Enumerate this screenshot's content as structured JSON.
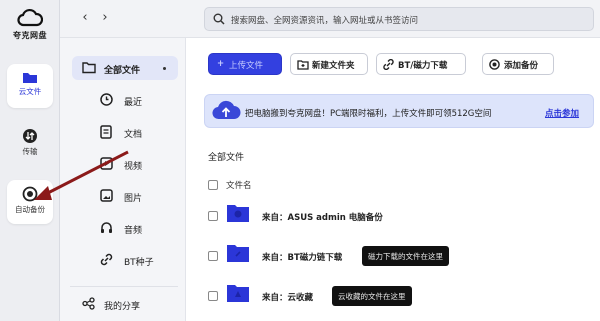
{
  "app": {
    "name": "夸克网盘"
  },
  "rail": {
    "items": [
      {
        "label": "云文件",
        "icon": "cloud-file-icon"
      },
      {
        "label": "传输",
        "icon": "transfer-icon"
      },
      {
        "label": "自动备份",
        "icon": "auto-backup-icon"
      }
    ]
  },
  "topbar": {
    "back": "‹",
    "forward": "›",
    "search_placeholder": "搜索网盘、全网资源资讯，输入网址或从书签访问"
  },
  "sidebar": {
    "items": [
      {
        "label": "全部文件",
        "icon": "folder-icon",
        "active": true
      },
      {
        "label": "最近",
        "icon": "clock-icon"
      },
      {
        "label": "文档",
        "icon": "document-icon"
      },
      {
        "label": "视频",
        "icon": "video-icon"
      },
      {
        "label": "图片",
        "icon": "image-icon"
      },
      {
        "label": "音频",
        "icon": "headphones-icon"
      },
      {
        "label": "BT种子",
        "icon": "link-icon"
      }
    ],
    "share": {
      "label": "我的分享",
      "icon": "share-icon"
    }
  },
  "toolbar": {
    "upload": "上传文件",
    "new_folder": "新建文件夹",
    "bt_download": "BT/磁力下载",
    "add_backup": "添加备份"
  },
  "banner": {
    "text": "把电脑搬到夸克网盘！PC端限时福利，上传文件即可领512G空间",
    "link": "点击参加"
  },
  "files": {
    "section_title": "全部文件",
    "column_name": "文件名",
    "rows": [
      {
        "name": "来自：ASUS admin 电脑备份",
        "tooltip": ""
      },
      {
        "name": "来自：BT磁力链下载",
        "tooltip": "磁力下载的文件在这里"
      },
      {
        "name": "来自：云收藏",
        "tooltip": "云收藏的文件在这里"
      }
    ]
  },
  "colors": {
    "accent": "#3340e0",
    "folder": "#2b36d8",
    "arrow": "#8b1a1a"
  }
}
